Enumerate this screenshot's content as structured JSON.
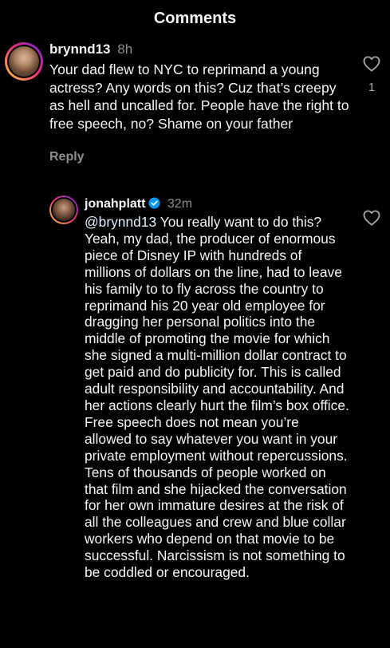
{
  "header": {
    "title": "Comments"
  },
  "comments": [
    {
      "username": "brynnd13",
      "time": "8h",
      "text": "Your dad flew to NYC to reprimand a young actress? Any words on this? Cuz that’s creepy as hell and uncalled for. People have the right to free speech, no? Shame on your father",
      "reply_label": "Reply",
      "like_count": "1",
      "heart_icon": "heart-outline-icon"
    },
    {
      "username": "jonahplatt",
      "verified_icon": "verified-badge-icon",
      "time": "32m",
      "mention": "@brynnd13",
      "text": " You really want to do this? Yeah, my dad, the producer of enormous piece of Disney IP with hundreds of millions of dollars on the line, had to leave his family to to fly across the country to reprimand his 20 year old employee for dragging her personal politics into the middle of promoting the movie for which she signed a multi-million dollar contract to get paid and do publicity for. This is called adult responsibility and accountability. And her actions clearly hurt the film’s box office. Free speech does not mean you’re allowed to say whatever you want in your private employment without repercussions. Tens of thousands of people worked on that film and she hijacked the conversation for her own immature desires at the risk of all the colleagues and crew and blue collar workers who depend on that movie to be successful. Narcissism is not something to be coddled or encouraged.",
      "heart_icon": "heart-outline-icon"
    }
  ],
  "colors": {
    "background": "#000000",
    "text": "#f5f5f5",
    "secondary_text": "#8e8e8e",
    "verified_blue": "#0095f6",
    "mention": "#e0f1ff"
  }
}
